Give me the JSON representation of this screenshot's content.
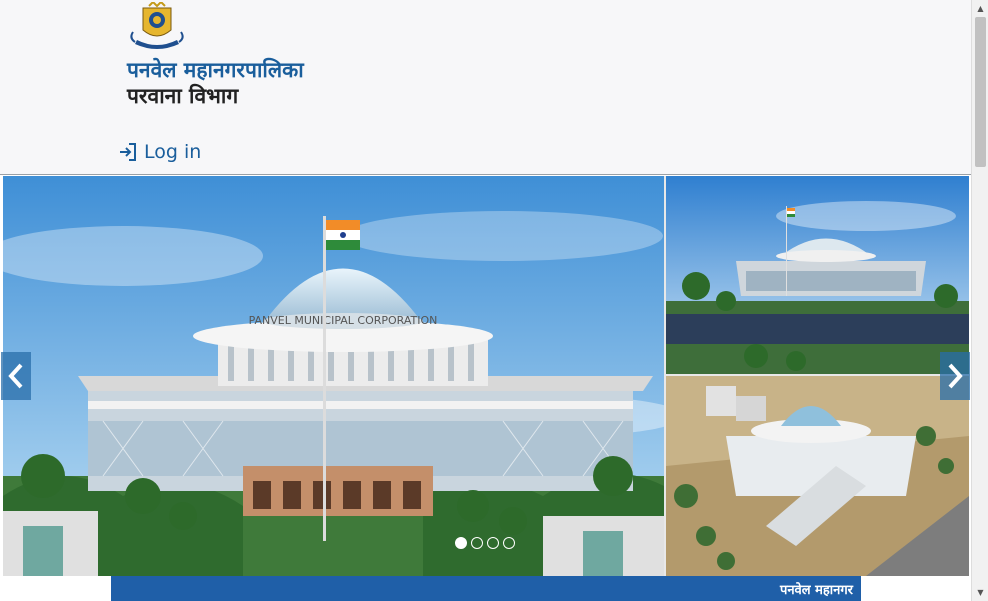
{
  "header": {
    "org_name": "पनवेल महानगरपालिका",
    "dept_name": "परवाना विभाग",
    "login_label": "Log in"
  },
  "carousel": {
    "slide_count": 4,
    "active_slide": 1,
    "building_sign": "PANVEL MUNICIPAL CORPORATION"
  },
  "ticker": {
    "text": "पनवेल महानगर"
  },
  "colors": {
    "brand_blue": "#1a5e9c",
    "ticker_bg": "#1f5fa8",
    "header_bg": "#f7f7f9"
  },
  "icons": {
    "login": "sign-in-icon",
    "prev": "chevron-left-icon",
    "next": "chevron-right-icon"
  }
}
